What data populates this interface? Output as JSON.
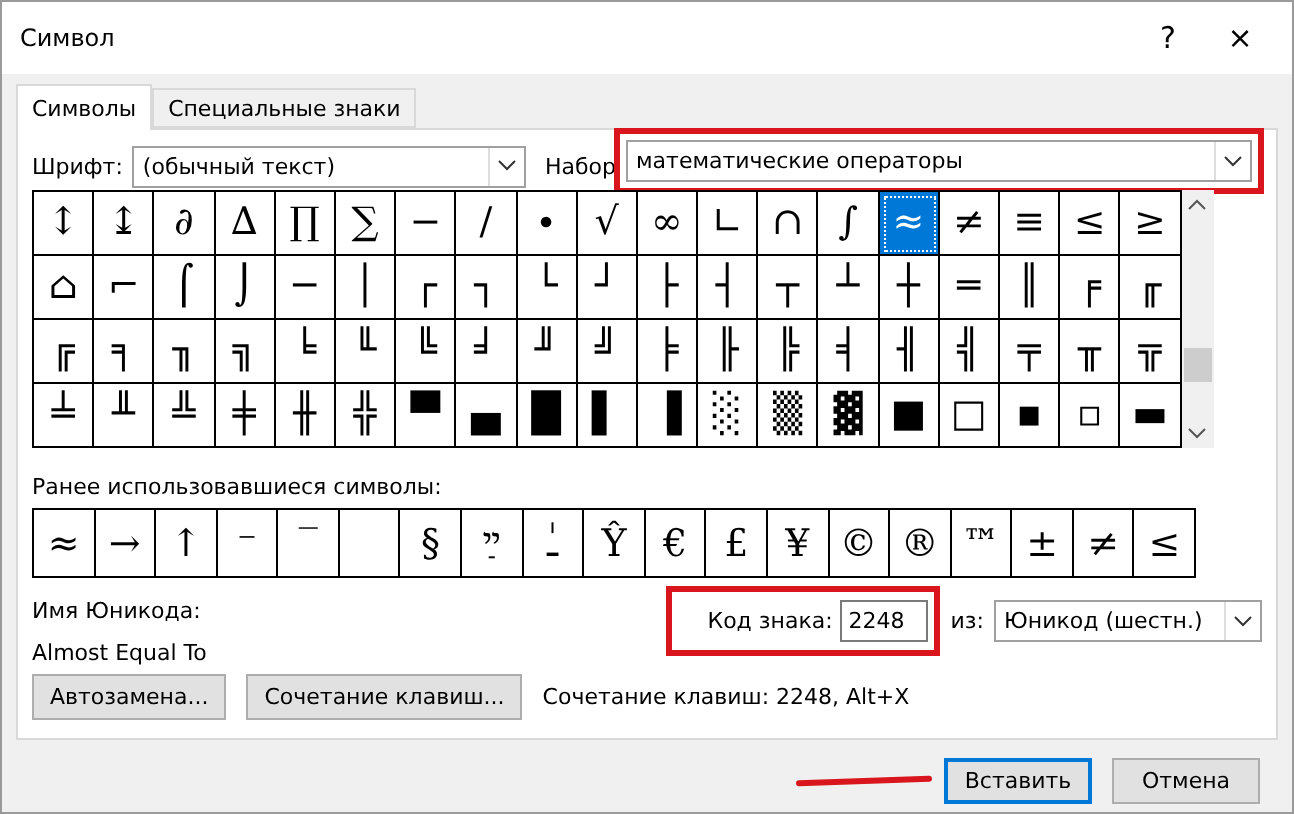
{
  "window": {
    "title": "Символ",
    "help": "?",
    "close": "×"
  },
  "tabs": [
    {
      "label": "Символы",
      "selected": true
    },
    {
      "label": "Специальные знаки",
      "selected": false
    }
  ],
  "font": {
    "label": "Шрифт:",
    "value": "(обычный текст)"
  },
  "subset": {
    "label": "Набор",
    "value": "математические операторы",
    "highlighted": true
  },
  "grid": [
    [
      {
        "char": "↕",
        "selected": false
      },
      {
        "char": "↨",
        "selected": false
      },
      {
        "char": "∂",
        "selected": false
      },
      {
        "char": "∆",
        "selected": false
      },
      {
        "char": "∏",
        "selected": false
      },
      {
        "char": "∑",
        "selected": false
      },
      {
        "char": "−",
        "selected": false
      },
      {
        "char": "∕",
        "selected": false
      },
      {
        "char": "∙",
        "selected": false
      },
      {
        "char": "√",
        "selected": false
      },
      {
        "char": "∞",
        "selected": false
      },
      {
        "char": "∟",
        "selected": false
      },
      {
        "char": "∩",
        "selected": false
      },
      {
        "char": "∫",
        "selected": false
      },
      {
        "char": "≈",
        "selected": true
      },
      {
        "char": "≠",
        "selected": false
      },
      {
        "char": "≡",
        "selected": false
      },
      {
        "char": "≤",
        "selected": false
      },
      {
        "char": "≥",
        "selected": false
      }
    ],
    [
      {
        "char": "⌂",
        "selected": false
      },
      {
        "char": "⌐",
        "selected": false
      },
      {
        "char": "⌠",
        "selected": false
      },
      {
        "char": "⌡",
        "selected": false
      },
      {
        "char": "─",
        "selected": false
      },
      {
        "char": "│",
        "selected": false
      },
      {
        "char": "┌",
        "selected": false
      },
      {
        "char": "┐",
        "selected": false
      },
      {
        "char": "└",
        "selected": false
      },
      {
        "char": "┘",
        "selected": false
      },
      {
        "char": "├",
        "selected": false
      },
      {
        "char": "┤",
        "selected": false
      },
      {
        "char": "┬",
        "selected": false
      },
      {
        "char": "┴",
        "selected": false
      },
      {
        "char": "┼",
        "selected": false
      },
      {
        "char": "═",
        "selected": false
      },
      {
        "char": "║",
        "selected": false
      },
      {
        "char": "╒",
        "selected": false
      },
      {
        "char": "╓",
        "selected": false
      }
    ],
    [
      {
        "char": "╔",
        "selected": false
      },
      {
        "char": "╕",
        "selected": false
      },
      {
        "char": "╖",
        "selected": false
      },
      {
        "char": "╗",
        "selected": false
      },
      {
        "char": "╘",
        "selected": false
      },
      {
        "char": "╙",
        "selected": false
      },
      {
        "char": "╚",
        "selected": false
      },
      {
        "char": "╛",
        "selected": false
      },
      {
        "char": "╜",
        "selected": false
      },
      {
        "char": "╝",
        "selected": false
      },
      {
        "char": "╞",
        "selected": false
      },
      {
        "char": "╟",
        "selected": false
      },
      {
        "char": "╠",
        "selected": false
      },
      {
        "char": "╡",
        "selected": false
      },
      {
        "char": "╢",
        "selected": false
      },
      {
        "char": "╣",
        "selected": false
      },
      {
        "char": "╤",
        "selected": false
      },
      {
        "char": "╥",
        "selected": false
      },
      {
        "char": "╦",
        "selected": false
      }
    ],
    [
      {
        "char": "╧",
        "selected": false
      },
      {
        "char": "╨",
        "selected": false
      },
      {
        "char": "╩",
        "selected": false
      },
      {
        "char": "╪",
        "selected": false
      },
      {
        "char": "╫",
        "selected": false
      },
      {
        "char": "╬",
        "selected": false
      },
      {
        "char": "▀",
        "selected": false
      },
      {
        "char": "▄",
        "selected": false
      },
      {
        "char": "█",
        "selected": false
      },
      {
        "char": "▌",
        "selected": false
      },
      {
        "char": "▐",
        "selected": false
      },
      {
        "char": "░",
        "selected": false
      },
      {
        "char": "▒",
        "selected": false
      },
      {
        "char": "▓",
        "selected": false
      },
      {
        "char": "■",
        "selected": false
      },
      {
        "char": "□",
        "selected": false
      },
      {
        "char": "▪",
        "selected": false
      },
      {
        "char": "▫",
        "selected": false
      },
      {
        "char": "▬",
        "selected": false
      }
    ]
  ],
  "recent": {
    "label": "Ранее использовавшиеся символы:",
    "items": [
      {
        "kind": "char",
        "char": "≈"
      },
      {
        "kind": "char",
        "char": "→"
      },
      {
        "kind": "char",
        "char": "↑"
      },
      {
        "kind": "char",
        "char": "⁻"
      },
      {
        "kind": "char",
        "char": "‾"
      },
      {
        "kind": "blank"
      },
      {
        "kind": "char",
        "char": "§"
      },
      {
        "kind": "char",
        "char": "ײַ"
      },
      {
        "kind": "char",
        "char": "ـٰ"
      },
      {
        "kind": "char",
        "char": "Ŷ"
      },
      {
        "kind": "char",
        "char": "€"
      },
      {
        "kind": "char",
        "char": "£"
      },
      {
        "kind": "char",
        "char": "¥"
      },
      {
        "kind": "char",
        "char": "©"
      },
      {
        "kind": "char",
        "char": "®"
      },
      {
        "kind": "char",
        "char": "™"
      },
      {
        "kind": "char",
        "char": "±"
      },
      {
        "kind": "char",
        "char": "≠"
      },
      {
        "kind": "char",
        "char": "≤"
      }
    ]
  },
  "unicode_name": {
    "label": "Имя Юникода:",
    "value": "Almost Equal To"
  },
  "char_code": {
    "label": "Код знака:",
    "value": "2248",
    "highlighted": true
  },
  "from": {
    "label": "из:",
    "value": "Юникод (шестн.)"
  },
  "buttons": [
    "Автозамена...",
    "Сочетание клавиш..."
  ],
  "shortcut": "Сочетание клавиш: 2248, Alt+X",
  "footer": [
    {
      "label": "Вставить",
      "default": true,
      "pointed": true
    },
    {
      "label": "Отмена",
      "default": false,
      "pointed": false
    }
  ]
}
